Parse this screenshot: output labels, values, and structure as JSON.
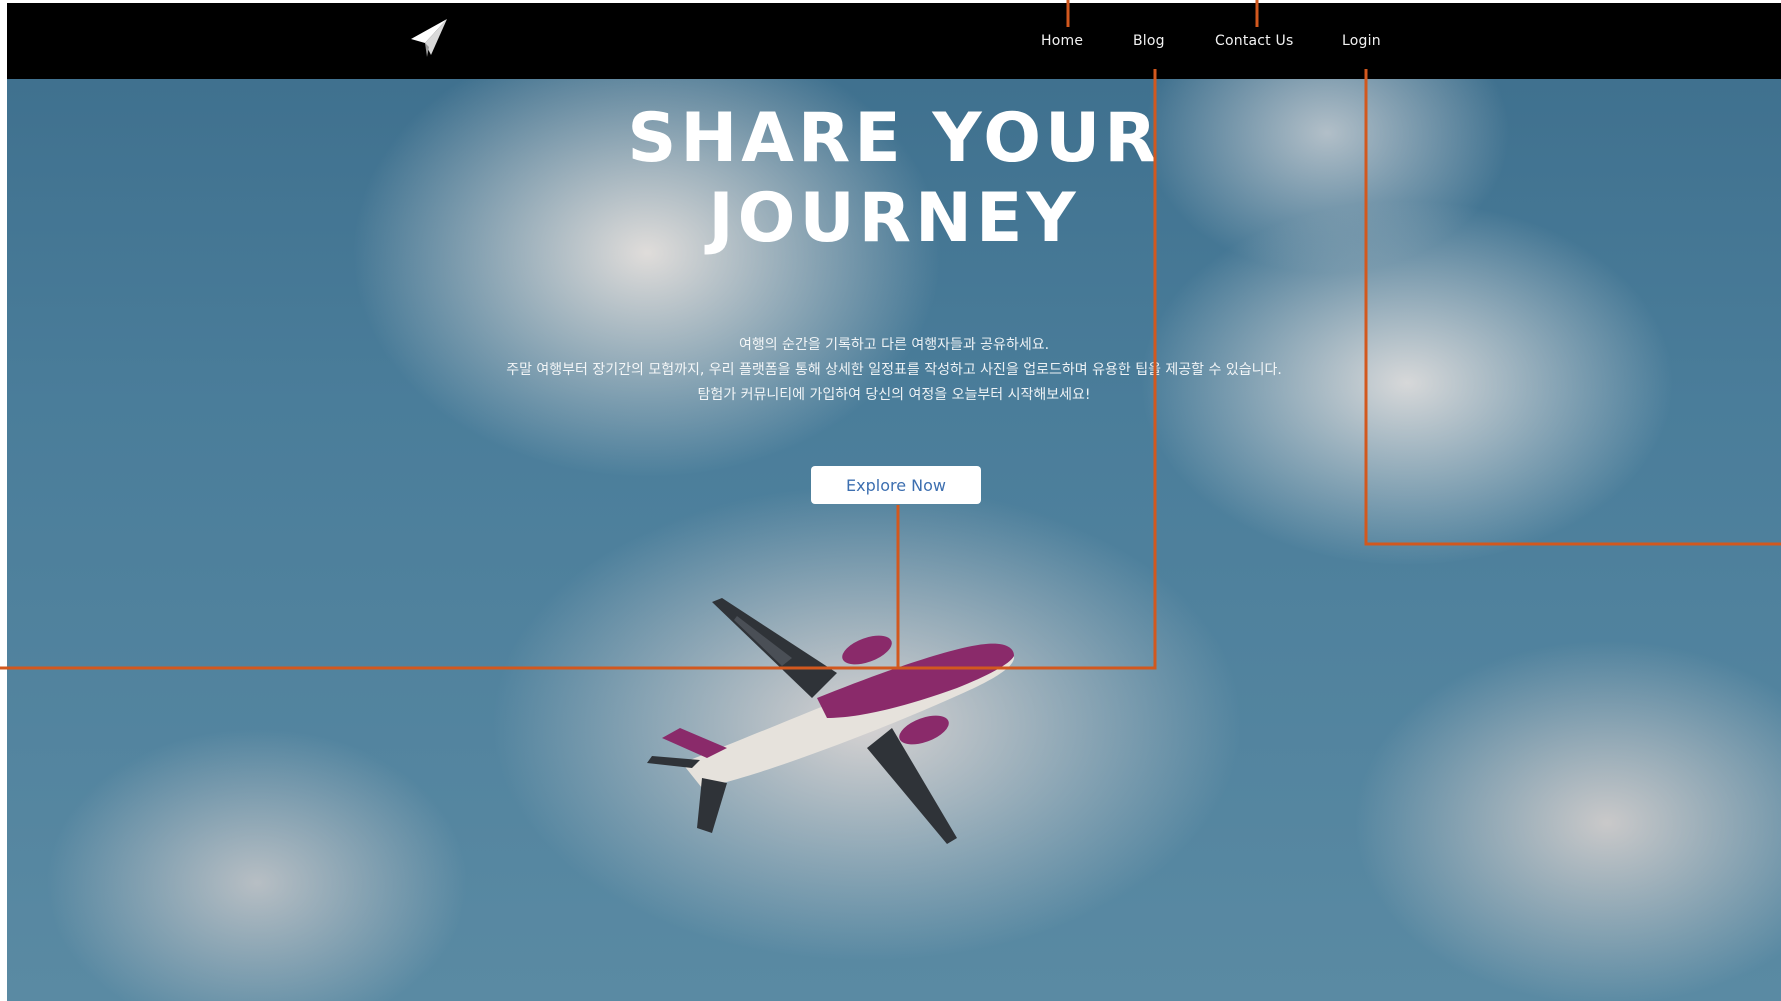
{
  "nav": {
    "items": [
      {
        "label": "Home"
      },
      {
        "label": "Blog"
      },
      {
        "label": "Contact Us"
      },
      {
        "label": "Login"
      }
    ]
  },
  "hero": {
    "title_line1": "SHARE YOUR",
    "title_line2": "JOURNEY",
    "description": [
      "여행의 순간을 기록하고 다른 여행자들과 공유하세요.",
      "주말 여행부터 장기간의 모험까지, 우리 플랫폼을 통해 상세한 일정표를 작성하고 사진을 업로드하며 유용한 팁을 제공할 수 있습니다.",
      "탐험가 커뮤니티에 가입하여 당신의 여정을 오늘부터 시작해보세요!"
    ],
    "cta_label": "Explore Now"
  },
  "colors": {
    "topbar": "#000000",
    "button_text": "#3d6fb0",
    "annotation_line": "#d2581e",
    "sky": "#4a7d9a"
  },
  "icons": {
    "logo": "paper-plane-icon"
  }
}
